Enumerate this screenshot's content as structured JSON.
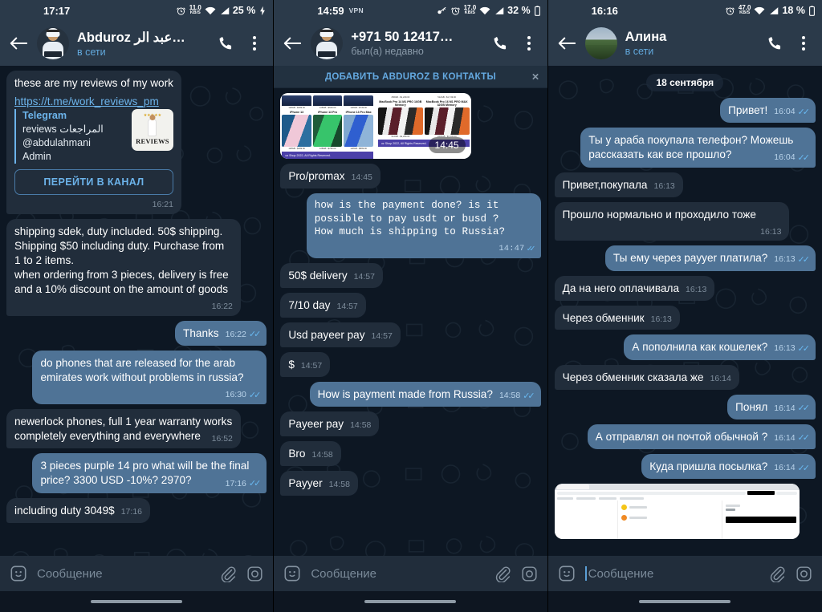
{
  "panels": [
    {
      "id": "panel-abduroz-en",
      "status": {
        "time": "17:17",
        "vpn": "",
        "speed": "11.0",
        "speed_unit": "KB/S",
        "battery": "25 %"
      },
      "header": {
        "name": "Abduroz عبد الر…",
        "subtitle": "в сети",
        "subtitle_state": "online"
      },
      "messages": [
        {
          "kind": "link-preview",
          "dir": "in",
          "head": "these are my reviews of my work",
          "link": "https://t.me/work_reviews_pm",
          "preview": {
            "site": "Telegram",
            "title": "reviews المراجعات",
            "username": "@abdulahmani",
            "role": "Admin",
            "thumb_caption": "REVIEWS"
          },
          "button": "ПЕРЕЙТИ В КАНАЛ",
          "time": "16:21"
        },
        {
          "kind": "text",
          "dir": "in",
          "text": "shipping sdek, duty included. 50$ shipping.\nShipping $50 including duty. Purchase from 1 to 2 items.\nwhen ordering from 3 pieces, delivery is free and a 10% discount on the amount of goods",
          "time": "16:22"
        },
        {
          "kind": "text",
          "dir": "out",
          "short": true,
          "text": "Thanks",
          "time": "16:22",
          "status": "read"
        },
        {
          "kind": "text",
          "dir": "out",
          "text": "do phones that are released for the arab emirates work without problems in russia?",
          "time": "16:30",
          "status": "read"
        },
        {
          "kind": "text",
          "dir": "in",
          "text": "newerlock phones, full 1 year warranty works completely everything and everywhere",
          "time": "16:52"
        },
        {
          "kind": "text",
          "dir": "out",
          "text": "3 pieces purple 14 pro what will be the final price? 3300 USD -10%? 2970?",
          "time": "17:16",
          "status": "read"
        },
        {
          "kind": "text",
          "dir": "in",
          "short": true,
          "text": "including duty 3049$",
          "time": "17:16"
        }
      ],
      "input": {
        "placeholder": "Сообщение",
        "caret": false
      }
    },
    {
      "id": "panel-abduroz-phone",
      "status": {
        "time": "14:59",
        "vpn": "VPN",
        "speed": "17.0",
        "speed_unit": "KB/S",
        "battery": "32 %"
      },
      "header": {
        "name": "+971 50 12417…",
        "subtitle": "был(а) недавно",
        "subtitle_state": "recent"
      },
      "banner": {
        "label": "ДОБАВИТЬ ABDUROZ В КОНТАКТЫ",
        "close": "×"
      },
      "messages": [
        {
          "kind": "photo-grid",
          "dir": "in",
          "time": "14:45",
          "products_left": [
            {
              "name": "iPhone 13",
              "prices_top": [
                "128GB - $499.00",
                "256GB - $549.00"
              ],
              "prices_bottom": [
                "128GB - $499.00",
                "256GB - $749.00",
                "512GB - $899.00"
              ]
            },
            {
              "name": "iPhone 13 Pro",
              "prices_top": [
                "128GB - $649.00",
                "256GB - $699.00"
              ],
              "prices_bottom": [
                "128GB - $799.00",
                "256GB - $899.00",
                "512GB - $999.00"
              ]
            },
            {
              "name": "iPhone 13 Pro Max",
              "prices_top": [
                "128GB - $749.00",
                "256GB - $799.00",
                "512GB - $899.00"
              ],
              "prices_bottom": [
                "128GB - $899.00",
                "256GB - $999.00",
                "512GB - $1,099.00"
              ]
            }
          ],
          "products_right": [
            {
              "name": "MacBook Pro 14 M1 PRO 16GB Memory",
              "prices_top": [
                "256GB - $1,249.00",
                "512GB - $1,499.00"
              ],
              "prices_bottom": [
                "512GB - $2,299.00",
                "1000GB - $2,499.00"
              ]
            },
            {
              "name": "MacBook Pro 16 M1 PRO MAX 32GB Memory",
              "prices_top": [
                "512GB - $1,749.00",
                "1000GB - $2,249.00"
              ],
              "prices_bottom": [
                "1000GB - $3,149.00"
              ]
            }
          ],
          "footer": "oz Shop 2022, All Rights Reserved."
        },
        {
          "kind": "text",
          "dir": "in",
          "short": true,
          "text": "Pro/promax",
          "time": "14:45"
        },
        {
          "kind": "text",
          "dir": "out",
          "mono": true,
          "text": "how is the payment done? is it\npossible to pay usdt or busd ?\nHow much is shipping to Russia?",
          "time": "14:47",
          "status": "read"
        },
        {
          "kind": "text",
          "dir": "in",
          "short": true,
          "text": "50$ delivery",
          "time": "14:57"
        },
        {
          "kind": "text",
          "dir": "in",
          "short": true,
          "text": "7/10 day",
          "time": "14:57"
        },
        {
          "kind": "text",
          "dir": "in",
          "short": true,
          "text": "Usd payeer pay",
          "time": "14:57"
        },
        {
          "kind": "text",
          "dir": "in",
          "short": true,
          "text": "$",
          "time": "14:57"
        },
        {
          "kind": "text",
          "dir": "out",
          "short": true,
          "text": "How is payment made from Russia?",
          "time": "14:58",
          "status": "read"
        },
        {
          "kind": "text",
          "dir": "in",
          "short": true,
          "text": "Payeer pay",
          "time": "14:58"
        },
        {
          "kind": "text",
          "dir": "in",
          "short": true,
          "text": "Bro",
          "time": "14:58"
        },
        {
          "kind": "text",
          "dir": "in",
          "short": true,
          "text": "Payyer",
          "time": "14:58"
        }
      ],
      "input": {
        "placeholder": "Сообщение",
        "caret": false
      }
    },
    {
      "id": "panel-alina",
      "status": {
        "time": "16:16",
        "vpn": "",
        "speed": "47.0",
        "speed_unit": "KB/S",
        "battery": "18 %"
      },
      "header": {
        "name": "Алина",
        "subtitle": "в сети",
        "subtitle_state": "online"
      },
      "date_divider": "18 сентября",
      "messages": [
        {
          "kind": "text",
          "dir": "out",
          "short": true,
          "text": "Привет!",
          "time": "16:04",
          "status": "read"
        },
        {
          "kind": "text",
          "dir": "out",
          "text": "Ты у араба покупала телефон? Можешь рассказать как все прошло?",
          "time": "16:04",
          "status": "read"
        },
        {
          "kind": "text",
          "dir": "in",
          "short": true,
          "text": "Привет,покупала",
          "time": "16:13"
        },
        {
          "kind": "text",
          "dir": "in",
          "text": "Прошло нормально и проходило тоже",
          "time": "16:13"
        },
        {
          "kind": "text",
          "dir": "out",
          "short": true,
          "text": "Ты ему через payyer платила?",
          "time": "16:13",
          "status": "read"
        },
        {
          "kind": "text",
          "dir": "in",
          "short": true,
          "text": "Да на него оплачивала",
          "time": "16:13"
        },
        {
          "kind": "text",
          "dir": "in",
          "short": true,
          "text": "Через обменник",
          "time": "16:13"
        },
        {
          "kind": "text",
          "dir": "out",
          "short": true,
          "text": "А пополнила как кошелек?",
          "time": "16:13",
          "status": "read"
        },
        {
          "kind": "text",
          "dir": "in",
          "short": true,
          "text": "Через обменник сказала же",
          "time": "16:14"
        },
        {
          "kind": "text",
          "dir": "out",
          "short": true,
          "text": "Понял",
          "time": "16:14",
          "status": "read"
        },
        {
          "kind": "text",
          "dir": "out",
          "short": true,
          "text": "А отправлял он почтой обычной ?",
          "time": "16:14",
          "status": "read"
        },
        {
          "kind": "text",
          "dir": "out",
          "short": true,
          "text": "Куда пришла посылка?",
          "time": "16:14",
          "status": "read"
        },
        {
          "kind": "browser-shot",
          "dir": "in",
          "tab_title": "Отследить заказ",
          "tracking_steps": [
            "Создан",
            "В пути"
          ]
        }
      ],
      "input": {
        "placeholder": "Сообщение",
        "caret": true
      }
    }
  ],
  "icons": {
    "back": "arrow-left",
    "call": "phone",
    "menu": "kebab-menu",
    "sticker": "sticker-smiley",
    "attach": "paperclip",
    "camera": "camera",
    "ticks": "✓✓"
  },
  "colors": {
    "header_bg": "#2b3a4a",
    "chat_bg": "#0d1723",
    "bubble_in": "#212d3b",
    "bubble_out": "#4f7396",
    "accent_link": "#6cb3ea",
    "tick_blue": "#68b8f0"
  }
}
